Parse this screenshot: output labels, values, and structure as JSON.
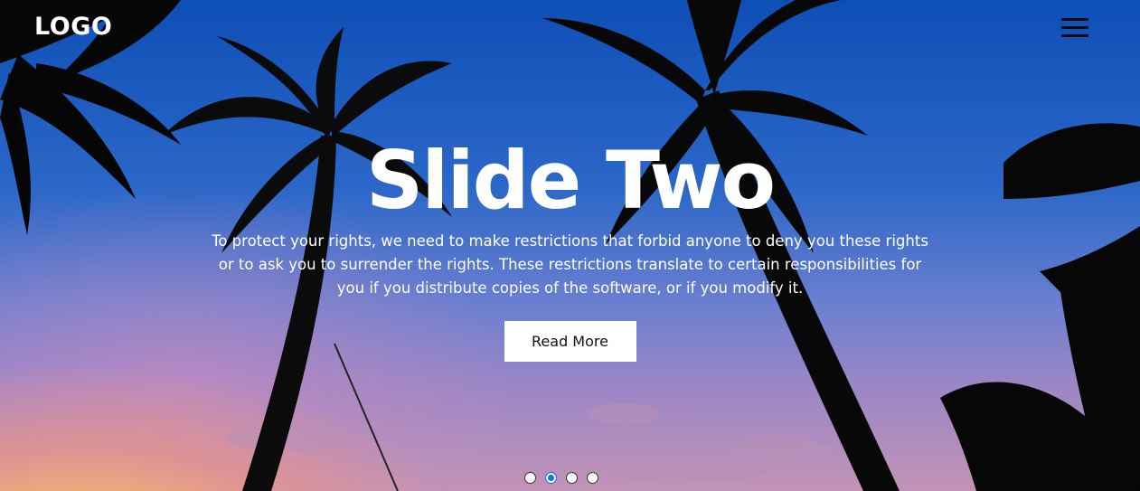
{
  "header": {
    "logo": "LOGO",
    "menu_icon": "hamburger-menu-icon"
  },
  "slider": {
    "title": "Slide Two",
    "description": "To protect your rights, we need to make restrictions that forbid anyone to deny you these rights or to ask you to surrender the rights. These restrictions translate to certain responsibilities for you if you distribute copies of the software, or if you modify it.",
    "button_label": "Read More",
    "slide_count": 4,
    "active_slide": 2
  },
  "colors": {
    "text": "#ffffff",
    "button_bg": "#ffffff",
    "button_text": "#111111",
    "active_dot": "#1d6fd8"
  }
}
